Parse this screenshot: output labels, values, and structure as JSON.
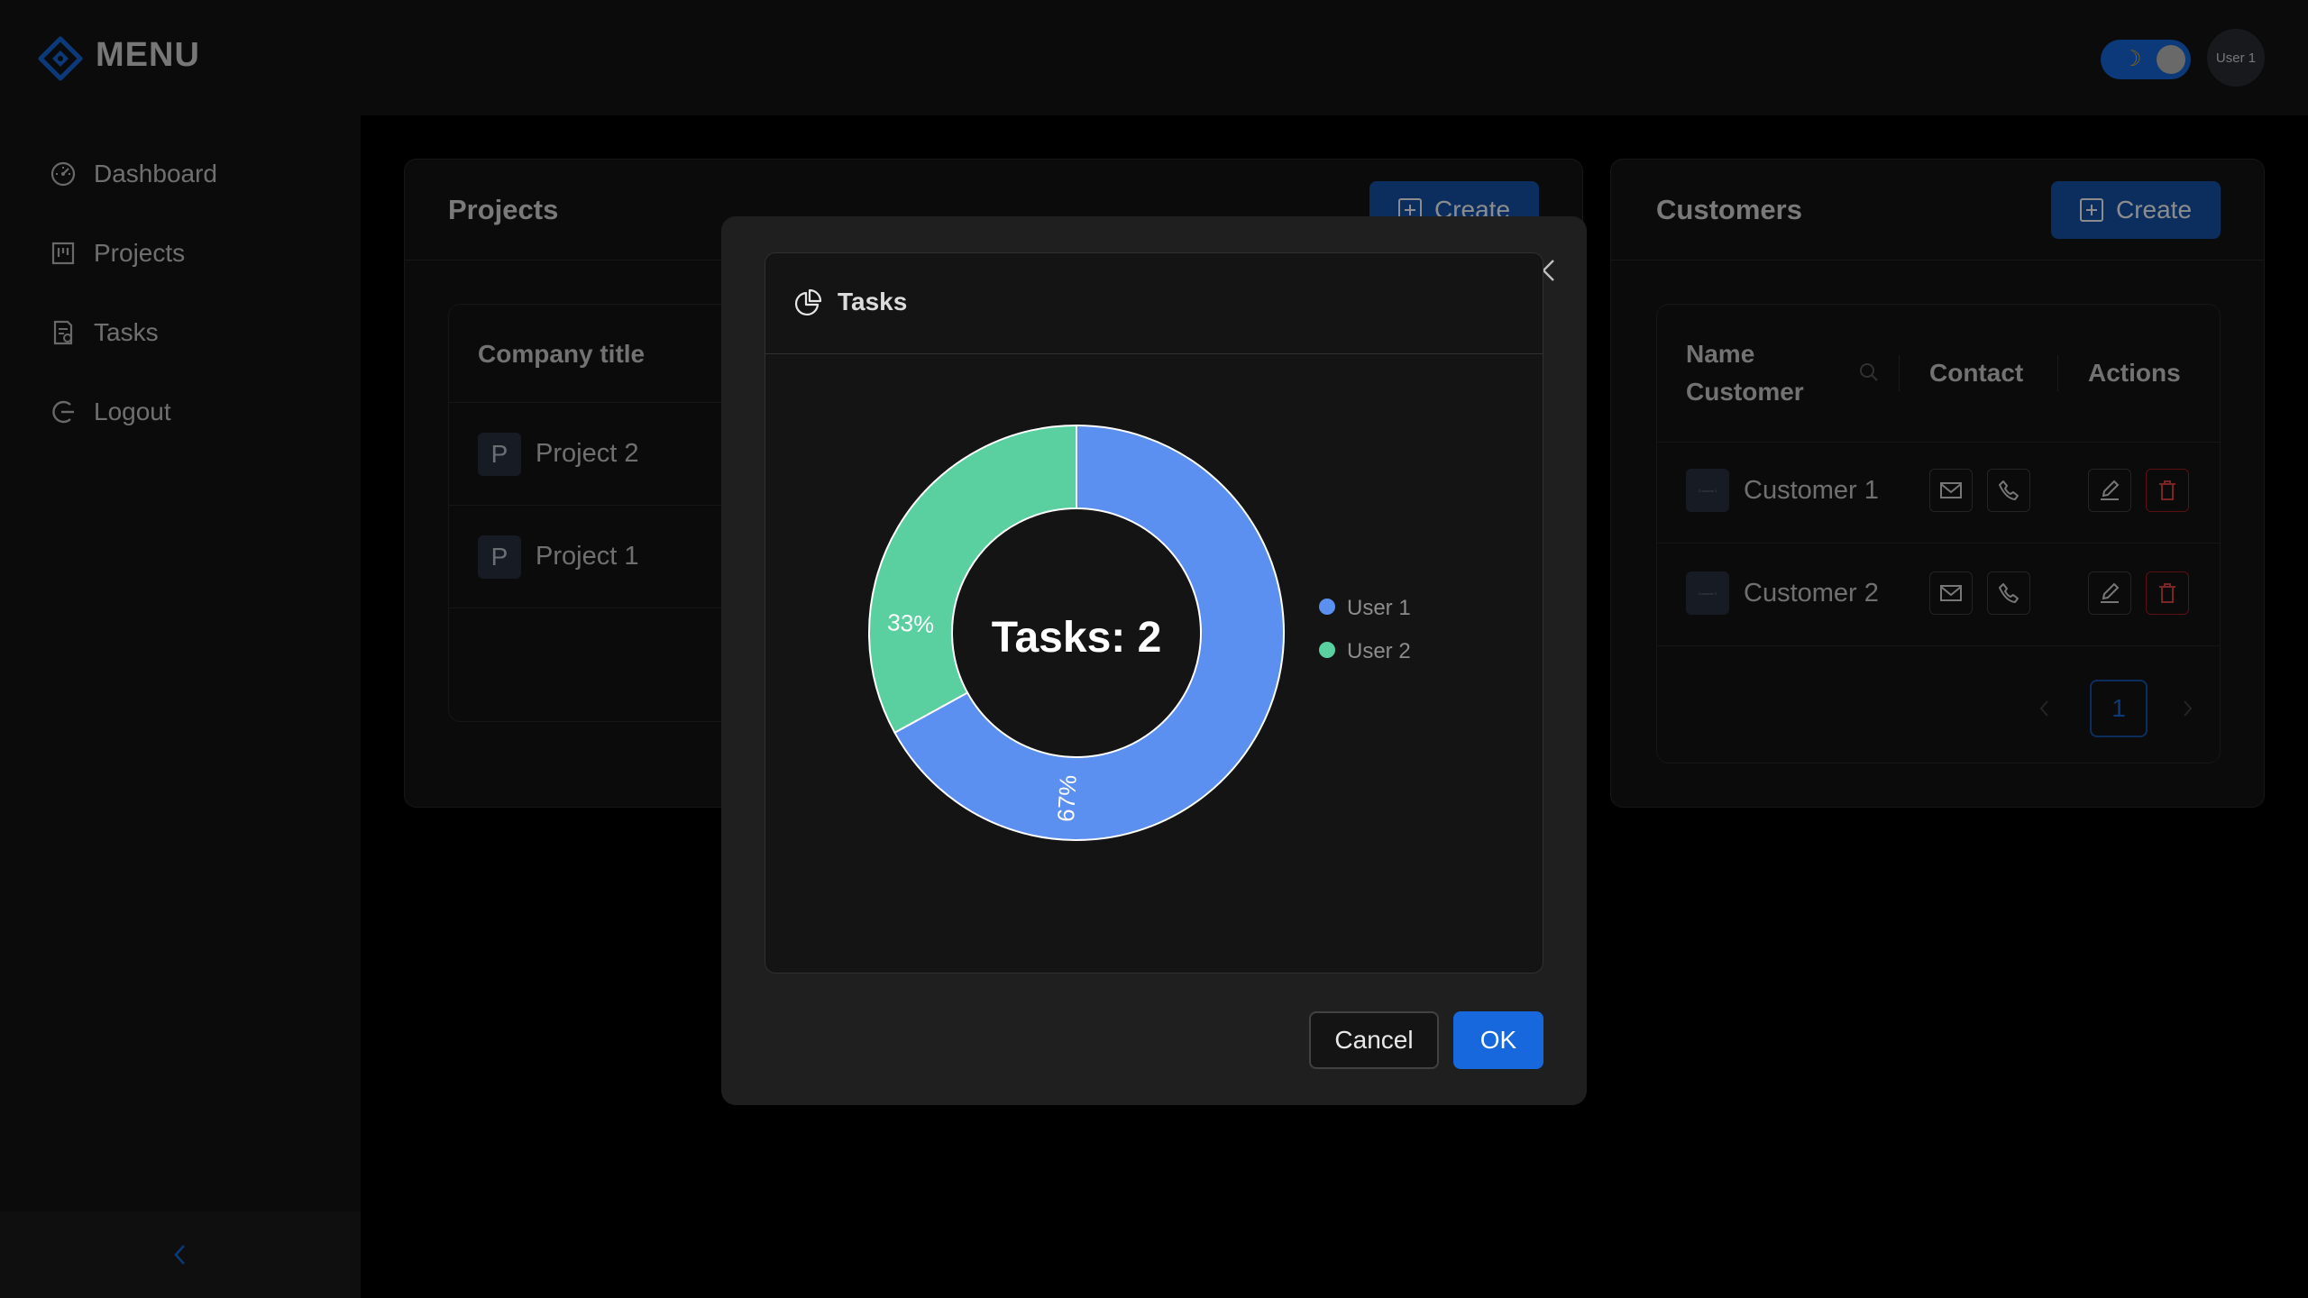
{
  "app": {
    "menu_title": "MENU",
    "user_avatar": "User 1"
  },
  "theme_toggle": {
    "icon": "moon-icon",
    "state": "dark"
  },
  "sidebar": {
    "items": [
      {
        "label": "Dashboard",
        "icon": "dashboard-icon"
      },
      {
        "label": "Projects",
        "icon": "projects-icon"
      },
      {
        "label": "Tasks",
        "icon": "tasks-icon"
      },
      {
        "label": "Logout",
        "icon": "logout-icon"
      }
    ],
    "collapse_icon": "chevron-left-icon"
  },
  "projects": {
    "title": "Projects",
    "create_label": "Create",
    "column_header": "Company title",
    "rows": [
      {
        "avatar": "P",
        "name": "Project 2"
      },
      {
        "avatar": "P",
        "name": "Project 1"
      }
    ]
  },
  "customers": {
    "title": "Customers",
    "create_label": "Create",
    "headers": {
      "name_line1": "Name",
      "name_line2": "Customer",
      "contact": "Contact",
      "actions": "Actions"
    },
    "rows": [
      {
        "avatar": "Customer 1",
        "name": "Customer 1"
      },
      {
        "avatar": "Customer 2",
        "name": "Customer 2"
      }
    ],
    "pagination": {
      "current_page": "1"
    }
  },
  "modal": {
    "title": "Tasks",
    "cancel_label": "Cancel",
    "ok_label": "OK",
    "colors": {
      "user1": "#5b8ff0",
      "user2": "#5ad0a0"
    }
  },
  "chart_data": {
    "type": "pie",
    "center_label": "Tasks: 2",
    "series": [
      {
        "name": "User 1",
        "value": 67,
        "label": "67%"
      },
      {
        "name": "User 2",
        "value": 33,
        "label": "33%"
      }
    ],
    "legend_position": "right"
  }
}
